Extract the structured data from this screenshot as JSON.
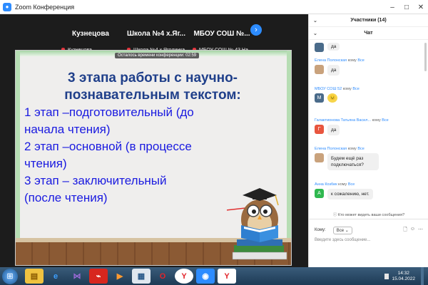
{
  "window": {
    "title": "Zoom Конференция",
    "buttons": [
      "–",
      "□",
      "✕"
    ]
  },
  "meeting": {
    "participants": [
      {
        "display": "Кузнецова",
        "label": "Кузнецова"
      },
      {
        "display": "Школа №4 х.Яг...",
        "label": "Школа №4 х.Ягодинка"
      },
      {
        "display": "МБОУ СОШ №...",
        "label": "МБОУ СОШ № 43 На..."
      }
    ],
    "next_icon": "›",
    "time_left": "Осталось времени конференции: 02:59"
  },
  "slide": {
    "heading_1": "3 этапа работы с научно-",
    "heading_2": "познавательным текстом:",
    "lines": [
      "1 этап –подготовительный (до",
      "начала чтения)",
      "2 этап –основной (в процессе",
      "чтения)",
      "3 этап – заключительный",
      "(после чтения)"
    ]
  },
  "panel": {
    "participants_title": "Участники (14)",
    "chat_title": "Чат",
    "to_word": "кому",
    "messages": [
      {
        "sender": "Елена Полонская",
        "to": "Все",
        "text": "да",
        "avatar": "",
        "color": "#c9a27c"
      },
      {
        "sender": "МБОУ СОШ 52",
        "to": "Все",
        "text": "😣",
        "avatar": "М",
        "color": "#4a6b8a"
      },
      {
        "sender": "Галактионова Татьяна Васил...",
        "to": "Все",
        "text": "да",
        "avatar": "Г",
        "color": "#e8553e"
      },
      {
        "sender": "Елена Полонская",
        "to": "Все",
        "text": "Будем ещё раз подключаться?",
        "avatar": "",
        "color": "#c9a27c"
      },
      {
        "sender": "Анна Козбик",
        "to": "Все",
        "text": "к сожалению, нет.",
        "avatar": "А",
        "color": "#2fb84f"
      }
    ],
    "who_sees": "Кто может видеть ваши сообщения?",
    "to_label": "Кому:",
    "to_value": "Все",
    "input_placeholder": "Введите здесь сообщение..."
  },
  "taskbar": {
    "icons": [
      "folder-icon",
      "ie-icon",
      "visual-studio-icon",
      "pdf-icon",
      "media-player-icon",
      "document-viewer-icon",
      "opera-icon",
      "yandex-icon",
      "zoom-icon",
      "yandex-browser-icon"
    ],
    "time": "14:32",
    "date": "15.04.2022"
  }
}
